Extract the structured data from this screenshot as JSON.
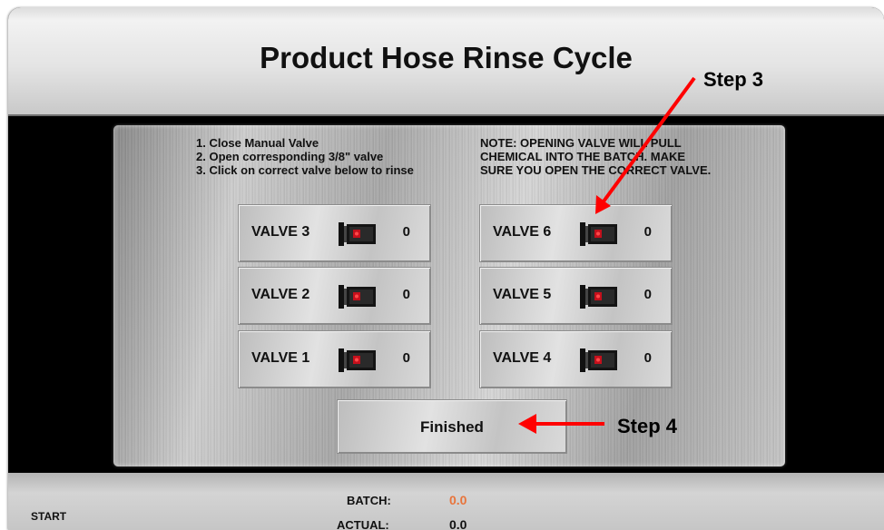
{
  "window": {
    "title": "Product Hose Rinse Cycle"
  },
  "instructions": [
    "1. Close Manual Valve",
    "2. Open corresponding 3/8\" valve",
    "3. Click on correct valve below to rinse"
  ],
  "note": [
    "NOTE:  OPENING VALVE WILL PULL",
    "CHEMICAL INTO THE BATCH. MAKE",
    "SURE YOU OPEN THE CORRECT VALVE."
  ],
  "valves": [
    {
      "label": "VALVE 3",
      "count": "0",
      "icon": "valve-icon"
    },
    {
      "label": "VALVE 6",
      "count": "0",
      "icon": "valve-icon"
    },
    {
      "label": "VALVE 2",
      "count": "0",
      "icon": "valve-icon"
    },
    {
      "label": "VALVE 5",
      "count": "0",
      "icon": "valve-icon"
    },
    {
      "label": "VALVE 1",
      "count": "0",
      "icon": "valve-icon"
    },
    {
      "label": "VALVE 4",
      "count": "0",
      "icon": "valve-icon"
    }
  ],
  "finished_label": "Finished",
  "annotations": {
    "step3": "Step 3",
    "step4": "Step 4",
    "arrow_color": "#ff0000"
  },
  "status": {
    "start_label": "START",
    "batch_label": "BATCH:",
    "batch_value": "0.0",
    "actual_label": "ACTUAL:",
    "actual_value": "0.0",
    "batch_value_color": "#e8743b"
  }
}
